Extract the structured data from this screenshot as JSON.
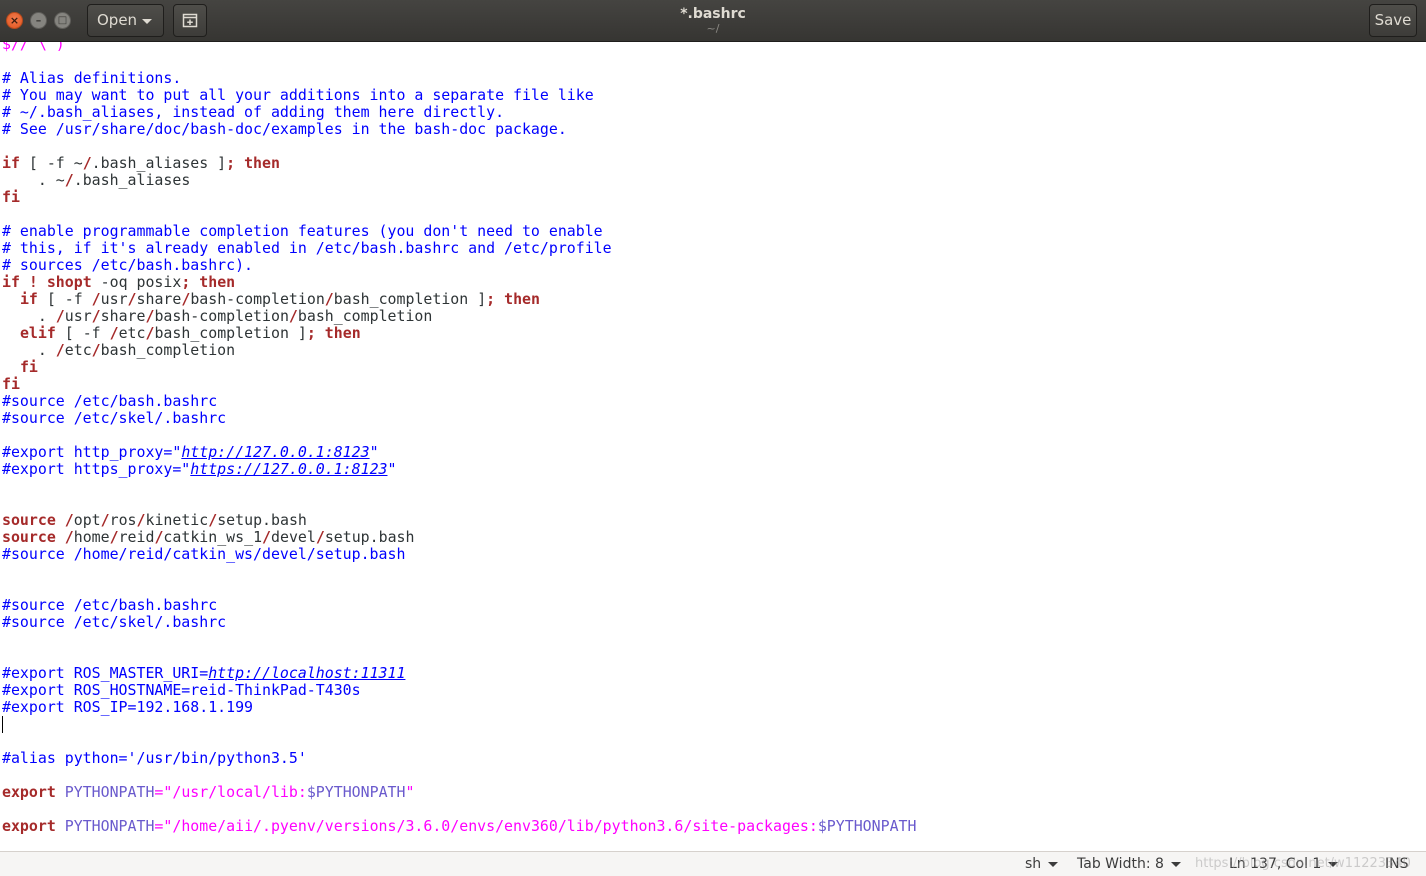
{
  "header": {
    "open_label": "Open",
    "save_label": "Save",
    "title": "*.bashrc",
    "subtitle": "~/"
  },
  "status": {
    "language": "sh",
    "tab_width": "Tab Width: 8",
    "position": "Ln 137, Col 1",
    "mode": "INS",
    "watermark": "https://blog.csdn.net/w11223340"
  },
  "editor": {
    "lines": [
      [
        {
          "t": "$// \\ )",
          "c": "str"
        }
      ],
      [],
      [
        {
          "t": "# Alias definitions.",
          "c": "cmt"
        }
      ],
      [
        {
          "t": "# You may want to put all your additions into a separate file like",
          "c": "cmt"
        }
      ],
      [
        {
          "t": "# ~/.bash_aliases, instead of adding them here directly.",
          "c": "cmt"
        }
      ],
      [
        {
          "t": "# See /usr/share/doc/bash-doc/examples in the bash-doc package.",
          "c": "cmt"
        }
      ],
      [],
      [
        {
          "t": "if",
          "c": "kw"
        },
        {
          "t": " [ -f ~"
        },
        {
          "t": "/",
          "c": "kw"
        },
        {
          "t": ".bash_aliases ]"
        },
        {
          "t": ";",
          "c": "kw"
        },
        {
          "t": " "
        },
        {
          "t": "then",
          "c": "kw"
        }
      ],
      [
        {
          "t": "    . ~"
        },
        {
          "t": "/",
          "c": "kw"
        },
        {
          "t": ".bash_aliases"
        }
      ],
      [
        {
          "t": "fi",
          "c": "kw"
        }
      ],
      [],
      [
        {
          "t": "# enable programmable completion features (you don't need to enable",
          "c": "cmt"
        }
      ],
      [
        {
          "t": "# this, if it's already enabled in /etc/bash.bashrc and /etc/profile",
          "c": "cmt"
        }
      ],
      [
        {
          "t": "# sources /etc/bash.bashrc).",
          "c": "cmt"
        }
      ],
      [
        {
          "t": "if",
          "c": "kw"
        },
        {
          "t": " "
        },
        {
          "t": "!",
          "c": "kw"
        },
        {
          "t": " "
        },
        {
          "t": "shopt",
          "c": "kw"
        },
        {
          "t": " -oq posix"
        },
        {
          "t": ";",
          "c": "kw"
        },
        {
          "t": " "
        },
        {
          "t": "then",
          "c": "kw"
        }
      ],
      [
        {
          "t": "  "
        },
        {
          "t": "if",
          "c": "kw"
        },
        {
          "t": " [ -f "
        },
        {
          "t": "/",
          "c": "kw"
        },
        {
          "t": "usr"
        },
        {
          "t": "/",
          "c": "kw"
        },
        {
          "t": "share"
        },
        {
          "t": "/",
          "c": "kw"
        },
        {
          "t": "bash-completion"
        },
        {
          "t": "/",
          "c": "kw"
        },
        {
          "t": "bash_completion ]"
        },
        {
          "t": ";",
          "c": "kw"
        },
        {
          "t": " "
        },
        {
          "t": "then",
          "c": "kw"
        }
      ],
      [
        {
          "t": "    . "
        },
        {
          "t": "/",
          "c": "kw"
        },
        {
          "t": "usr"
        },
        {
          "t": "/",
          "c": "kw"
        },
        {
          "t": "share"
        },
        {
          "t": "/",
          "c": "kw"
        },
        {
          "t": "bash-completion"
        },
        {
          "t": "/",
          "c": "kw"
        },
        {
          "t": "bash_completion"
        }
      ],
      [
        {
          "t": "  "
        },
        {
          "t": "elif",
          "c": "kw"
        },
        {
          "t": " [ -f "
        },
        {
          "t": "/",
          "c": "kw"
        },
        {
          "t": "etc"
        },
        {
          "t": "/",
          "c": "kw"
        },
        {
          "t": "bash_completion ]"
        },
        {
          "t": ";",
          "c": "kw"
        },
        {
          "t": " "
        },
        {
          "t": "then",
          "c": "kw"
        }
      ],
      [
        {
          "t": "    . "
        },
        {
          "t": "/",
          "c": "kw"
        },
        {
          "t": "etc"
        },
        {
          "t": "/",
          "c": "kw"
        },
        {
          "t": "bash_completion"
        }
      ],
      [
        {
          "t": "  "
        },
        {
          "t": "fi",
          "c": "kw"
        }
      ],
      [
        {
          "t": "fi",
          "c": "kw"
        }
      ],
      [
        {
          "t": "#source /etc/bash.bashrc",
          "c": "cmt"
        }
      ],
      [
        {
          "t": "#source /etc/skel/.bashrc",
          "c": "cmt"
        }
      ],
      [],
      [
        {
          "t": "#export http_proxy=\"",
          "c": "cmt"
        },
        {
          "t": "http://127.0.0.1:8123",
          "c": "url"
        },
        {
          "t": "\"",
          "c": "cmt"
        }
      ],
      [
        {
          "t": "#export https_proxy=\"",
          "c": "cmt"
        },
        {
          "t": "https://127.0.0.1:8123",
          "c": "url"
        },
        {
          "t": "\"",
          "c": "cmt"
        }
      ],
      [],
      [],
      [
        {
          "t": "source",
          "c": "kw"
        },
        {
          "t": " "
        },
        {
          "t": "/",
          "c": "kw"
        },
        {
          "t": "opt"
        },
        {
          "t": "/",
          "c": "kw"
        },
        {
          "t": "ros"
        },
        {
          "t": "/",
          "c": "kw"
        },
        {
          "t": "kinetic"
        },
        {
          "t": "/",
          "c": "kw"
        },
        {
          "t": "setup.bash"
        }
      ],
      [
        {
          "t": "source",
          "c": "kw"
        },
        {
          "t": " "
        },
        {
          "t": "/",
          "c": "kw"
        },
        {
          "t": "home"
        },
        {
          "t": "/",
          "c": "kw"
        },
        {
          "t": "reid"
        },
        {
          "t": "/",
          "c": "kw"
        },
        {
          "t": "catkin_ws_1"
        },
        {
          "t": "/",
          "c": "kw"
        },
        {
          "t": "devel"
        },
        {
          "t": "/",
          "c": "kw"
        },
        {
          "t": "setup.bash"
        }
      ],
      [
        {
          "t": "#source /home/reid/catkin_ws/devel/setup.bash",
          "c": "cmt"
        }
      ],
      [],
      [],
      [
        {
          "t": "#source /etc/bash.bashrc",
          "c": "cmt"
        }
      ],
      [
        {
          "t": "#source /etc/skel/.bashrc",
          "c": "cmt"
        }
      ],
      [],
      [],
      [
        {
          "t": "#export ROS_MASTER_URI=",
          "c": "cmt"
        },
        {
          "t": "http://localhost:11311",
          "c": "url"
        }
      ],
      [
        {
          "t": "#export ROS_HOSTNAME=reid-ThinkPad-T430s",
          "c": "cmt"
        }
      ],
      [
        {
          "t": "#export ROS_IP=192.168.1.199",
          "c": "cmt"
        }
      ],
      [
        {
          "cursor": true
        }
      ],
      [],
      [
        {
          "t": "#alias python='/usr/bin/python3.5'",
          "c": "cmt"
        }
      ],
      [],
      [
        {
          "t": "export",
          "c": "kw"
        },
        {
          "t": " "
        },
        {
          "t": "PYTHONPATH",
          "c": "var"
        },
        {
          "t": "=",
          "c": "str"
        },
        {
          "t": "\"/usr/local/lib:",
          "c": "str"
        },
        {
          "t": "$PYTHONPATH",
          "c": "var"
        },
        {
          "t": "\"",
          "c": "str"
        }
      ],
      [],
      [
        {
          "t": "export",
          "c": "kw"
        },
        {
          "t": " "
        },
        {
          "t": "PYTHONPATH",
          "c": "var"
        },
        {
          "t": "=",
          "c": "str"
        },
        {
          "t": "\"/home/aii/.pyenv/versions/3.6.0/envs/env360/lib/python3.6/site-packages:",
          "c": "str"
        },
        {
          "t": "$PYTHONPATH",
          "c": "var"
        }
      ]
    ]
  }
}
